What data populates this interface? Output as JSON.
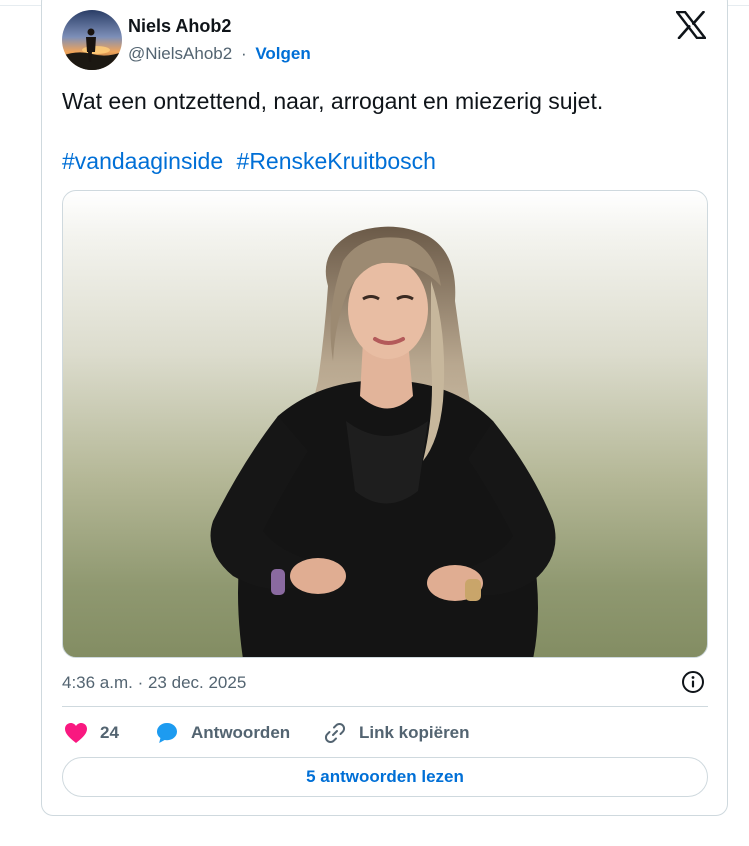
{
  "tweet": {
    "author_name": "Niels Ahob2",
    "handle": "@NielsAhob2",
    "separator": "·",
    "follow_label": "Volgen",
    "text": "Wat een ontzettend, naar, arrogant en miezerig sujet.",
    "hashtags": [
      "#vandaaginside",
      "#RenskeKruitbosch"
    ],
    "timestamp": "4:36 a.m. · 23 dec. 2025"
  },
  "actions": {
    "like_count": "24",
    "reply_label": "Antwoorden",
    "copy_label": "Link kopiëren"
  },
  "read_replies_label": "5 antwoorden lezen",
  "colors": {
    "link": "#006fd6",
    "like": "#f91880",
    "reply": "#1d9bf0",
    "muted": "#536471",
    "border": "#cfd9de"
  },
  "icons": {
    "brand": "x-logo-icon",
    "info": "info-icon",
    "like": "heart-icon",
    "reply": "speech-bubble-icon",
    "copy": "link-icon"
  }
}
